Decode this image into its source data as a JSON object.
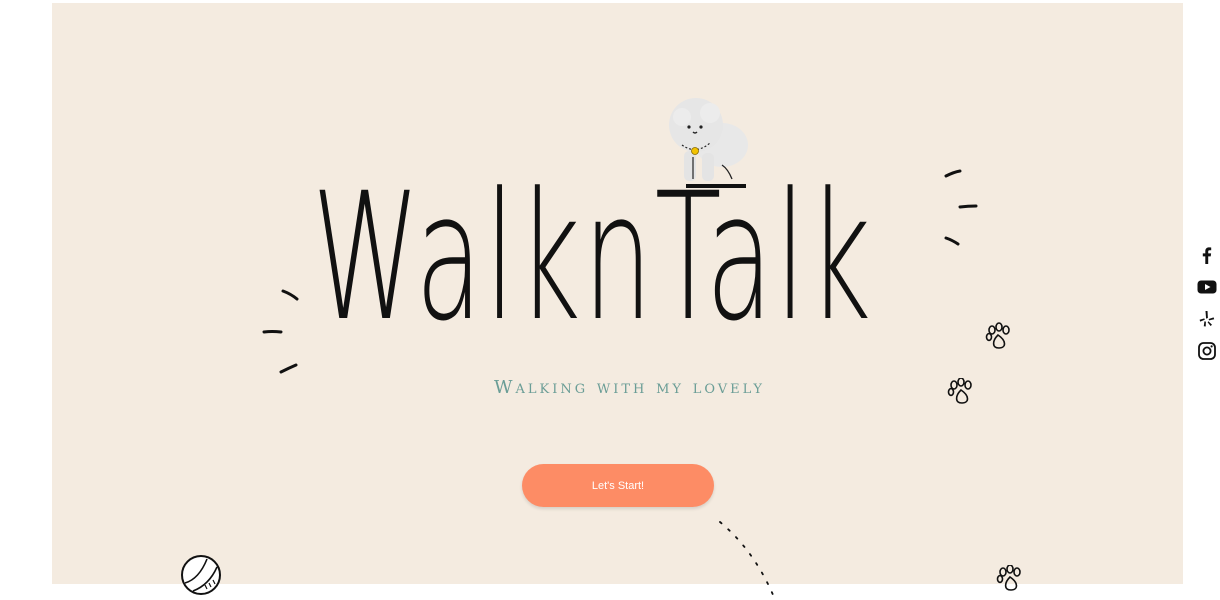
{
  "hero": {
    "title": "WalknTalk",
    "subtitle": "Walking with my lovely",
    "cta_label": "Let's Start!"
  },
  "social": {
    "items": [
      {
        "name": "facebook-icon"
      },
      {
        "name": "youtube-icon"
      },
      {
        "name": "yelp-icon"
      },
      {
        "name": "instagram-icon"
      }
    ]
  },
  "colors": {
    "hero_background": "#f4ebe0",
    "accent_button": "#fd8c65",
    "subtitle_text": "#6a9d96",
    "title_text": "#111111"
  },
  "decorations": [
    "dog-illustration",
    "paw-print-icon",
    "ball-icon",
    "sparkle-lines"
  ]
}
